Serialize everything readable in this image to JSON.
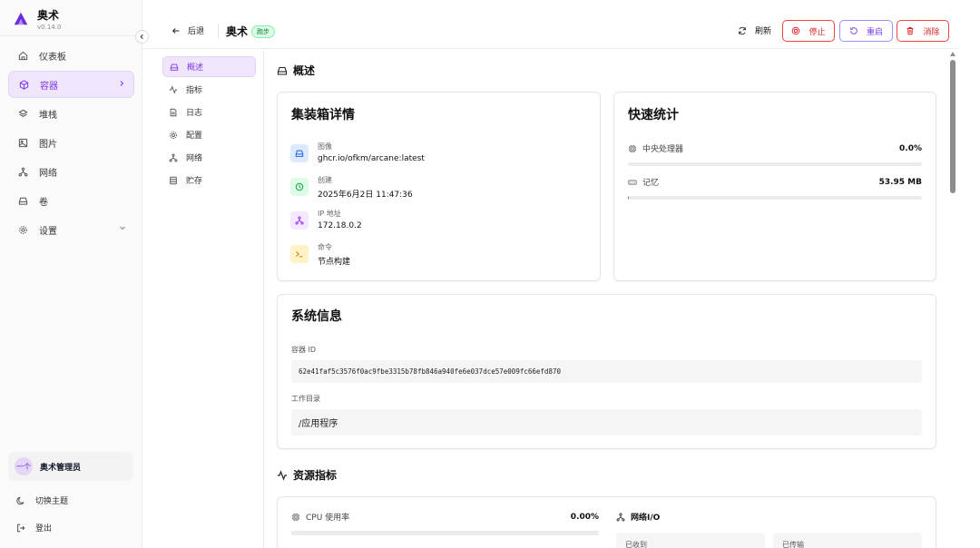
{
  "app": {
    "name": "奥术",
    "version": "v0.14.0"
  },
  "sidebar": {
    "items": [
      {
        "label": "仪表板",
        "icon": "home-icon"
      },
      {
        "label": "容器",
        "icon": "box-icon",
        "active": true
      },
      {
        "label": "堆栈",
        "icon": "layers-icon"
      },
      {
        "label": "图片",
        "icon": "image-icon"
      },
      {
        "label": "网络",
        "icon": "network-icon"
      },
      {
        "label": "卷",
        "icon": "drive-icon"
      },
      {
        "label": "设置",
        "icon": "gear-icon"
      }
    ],
    "user": {
      "avatar_text": "一个",
      "name": "奥术管理员"
    },
    "theme_label": "切换主题",
    "logout_label": "登出"
  },
  "header": {
    "back_label": "后退",
    "title": "奥术",
    "status_badge": "跑步",
    "refresh_label": "刷新",
    "stop_label": "停止",
    "restart_label": "重启",
    "remove_label": "消除"
  },
  "subnav": {
    "items": [
      {
        "label": "概述",
        "icon": "drive-icon",
        "active": true
      },
      {
        "label": "指标",
        "icon": "activity-icon"
      },
      {
        "label": "日志",
        "icon": "file-icon"
      },
      {
        "label": "配置",
        "icon": "gear-icon"
      },
      {
        "label": "网络",
        "icon": "network-icon"
      },
      {
        "label": "贮存",
        "icon": "database-icon"
      }
    ]
  },
  "overview": {
    "section_title": "概述",
    "details_card": {
      "title": "集装箱详情",
      "image_label": "图像",
      "image_value": "ghcr.io/ofkm/arcane:latest",
      "created_label": "创建",
      "created_value": "2025年6月2日 11:47:36",
      "ip_label": "IP 地址",
      "ip_value": "172.18.0.2",
      "command_label": "命令",
      "command_value": "节点构建"
    },
    "stats_card": {
      "title": "快速统计",
      "cpu_label": "中央处理器",
      "cpu_value": "0.0%",
      "cpu_fraction": 0.0,
      "memory_label": "记忆",
      "memory_value": "53.95 MB",
      "memory_fraction": 0.003
    },
    "system_card": {
      "title": "系统信息",
      "container_id_label": "容器 ID",
      "container_id_value": "62e41faf5c3576f0ac9fbe3315b78fb846a940fe6e037dce57e009fc66efd870",
      "workdir_label": "工作目录",
      "workdir_value": "/应用程序"
    }
  },
  "metrics": {
    "section_title": "资源指标",
    "cpu_usage_label": "CPU 使用率",
    "cpu_usage_value": "0.00%",
    "network_io_label": "网络I/O",
    "received_label": "已收到",
    "sent_label": "已传输"
  },
  "colors": {
    "accent": "#7c3aed",
    "accent_bg": "#f0e6fb",
    "danger": "#dc2626",
    "success_bg": "#dcfce7",
    "success_text": "#15803d"
  }
}
